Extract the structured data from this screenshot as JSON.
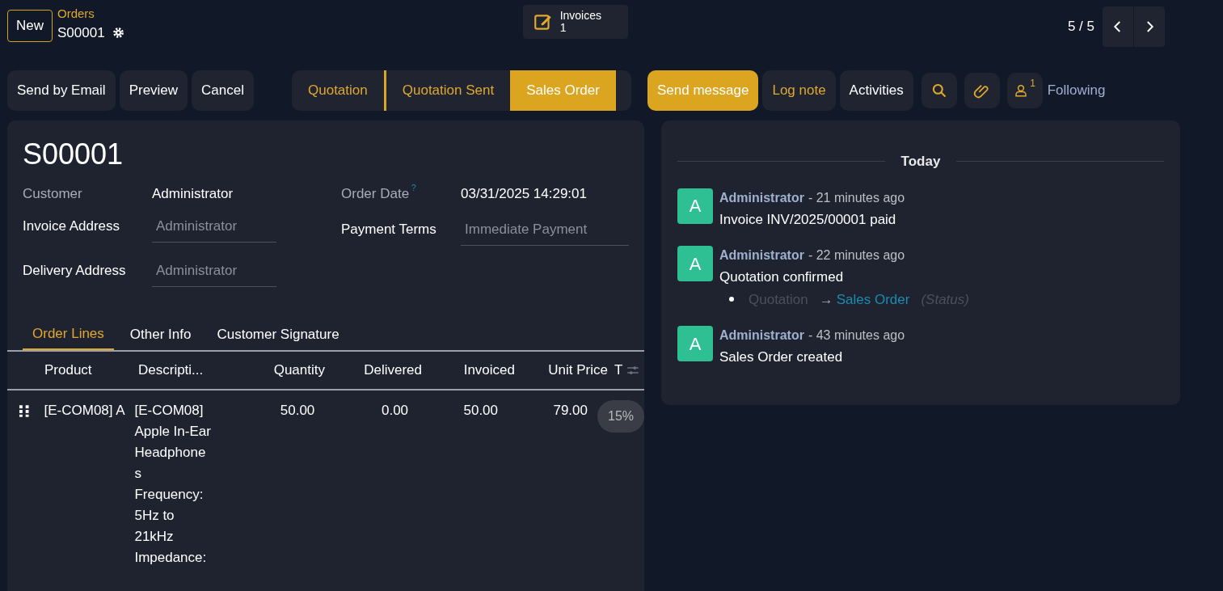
{
  "header": {
    "new_button": "New",
    "breadcrumb": "Orders",
    "record": "S00001",
    "smart_button": {
      "label": "Invoices",
      "count": "1"
    },
    "pager": "5 / 5"
  },
  "actions": [
    "Send by Email",
    "Preview",
    "Cancel"
  ],
  "stages": [
    {
      "label": "Quotation",
      "selected": false
    },
    {
      "label": "Quotation Sent",
      "selected": false
    },
    {
      "label": "Sales Order",
      "selected": true
    }
  ],
  "chatter_buttons": [
    {
      "label": "Send message",
      "selected": true
    },
    {
      "label": "Log note",
      "selected": false
    },
    {
      "label": "Activities",
      "selected": false
    }
  ],
  "followers": {
    "count": "1",
    "label": "Following"
  },
  "form": {
    "title": "S00001",
    "left_fields": [
      {
        "label": "Customer",
        "value": "Administrator",
        "kind": "text"
      },
      {
        "label": "Invoice Address",
        "placeholder": "Administrator",
        "kind": "input"
      },
      {
        "label": "Delivery Address",
        "placeholder": "Administrator",
        "kind": "input"
      }
    ],
    "right_fields": [
      {
        "label": "Order Date",
        "help": "?",
        "value": "03/31/2025 14:29:01",
        "kind": "text"
      },
      {
        "label": "Payment Terms",
        "placeholder": "Immediate Payment",
        "kind": "input"
      }
    ],
    "tabs": [
      {
        "label": "Order Lines",
        "selected": true
      },
      {
        "label": "Other Info",
        "selected": false
      },
      {
        "label": "Customer Signature",
        "selected": false
      }
    ],
    "table": {
      "columns": [
        "Product",
        "Descripti...",
        "Quantity",
        "Delivered",
        "Invoiced",
        "Unit Price",
        "T"
      ],
      "rows": [
        {
          "product": "[E-COM08] A",
          "description": [
            "[E-COM08]",
            "Apple In-Ear",
            "Headphone",
            "s",
            "Frequency:",
            "5Hz to",
            "21kHz",
            "Impedance:"
          ],
          "quantity": "50.00",
          "delivered": "0.00",
          "invoiced": "50.00",
          "unit_price": "79.00",
          "tax": "15%"
        }
      ]
    }
  },
  "chatter": {
    "date_label": "Today",
    "messages": [
      {
        "avatar": "A",
        "author": "Administrator",
        "time": "- 21 minutes ago",
        "body": "Invoice INV/2025/00001 paid"
      },
      {
        "avatar": "A",
        "author": "Administrator",
        "time": "- 22 minutes ago",
        "body": "Quotation confirmed",
        "tracking": {
          "old": "Quotation",
          "arrow": "→",
          "new": "Sales Order",
          "field": "(Status)"
        }
      },
      {
        "avatar": "A",
        "author": "Administrator",
        "time": "- 43 minutes ago",
        "body": "Sales Order created"
      }
    ]
  }
}
